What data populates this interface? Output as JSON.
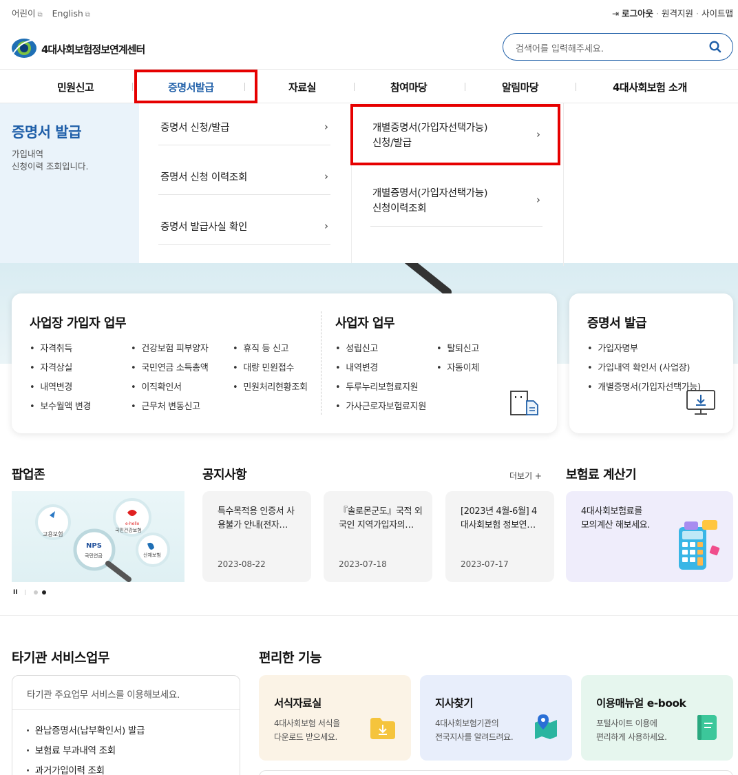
{
  "utility": {
    "kids": "어린이",
    "english": "English",
    "logout": "로그아웃",
    "remote": "원격지원",
    "sitemap": "사이트맵",
    "dot": "·"
  },
  "brand": {
    "name": "4대사회보험정보연계센터"
  },
  "search": {
    "placeholder": "검색어를 입력해주세요."
  },
  "gnb": [
    "민원신고",
    "증명서발급",
    "자료실",
    "참여마당",
    "알림마당",
    "4대사회보험 소개"
  ],
  "dropdown": {
    "title": "증명서 발급",
    "desc1": "가입내역",
    "desc2": "신청이력 조회입니다.",
    "col1": [
      "증명서 신청/발급",
      "증명서 신청 이력조회",
      "증명서 발급사실 확인"
    ],
    "col2": [
      {
        "l1": "개별증명서(가입자선택가능)",
        "l2": "신청/발급"
      },
      {
        "l1": "개별증명서(가입자선택가능)",
        "l2": "신청이력조회"
      }
    ]
  },
  "cards": {
    "biz_member": {
      "title": "사업장 가입자 업무",
      "items": [
        "자격취득",
        "자격상실",
        "내역변경",
        "보수월액 변경",
        "건강보험 피부양자",
        "국민연금 소득총액",
        "이직확인서",
        "근무처 변동신고",
        "휴직 등 신고",
        "대량 민원접수",
        "민원처리현황조회"
      ]
    },
    "employer": {
      "title": "사업자 업무",
      "items": [
        "성립신고",
        "내역변경",
        "두루누리보험료지원",
        "가사근로자보험료지원",
        "탈퇴신고",
        "자동이체"
      ]
    },
    "cert": {
      "title": "증명서 발급",
      "items": [
        "가입자명부",
        "가입내역 확인서 (사업장)",
        "개별증명서(가입자선택가능)"
      ]
    }
  },
  "popup": {
    "title": "팝업존",
    "labels": {
      "employment": "고용보험",
      "health1": "e-hello",
      "health2": "국민건강보험",
      "nps": "NPS",
      "nps_sub": "국민연금",
      "industrial": "산재보험"
    },
    "pause": "II"
  },
  "notices": {
    "title": "공지사항",
    "more": "더보기 +",
    "items": [
      {
        "title": "특수목적용 인증서 사용불가 안내(전자…",
        "date": "2023-08-22"
      },
      {
        "title": "『솔로몬군도』국적 외국인 지역가입자의…",
        "date": "2023-07-18"
      },
      {
        "title": "[2023년 4월-6월] 4대사회보험 정보연…",
        "date": "2023-07-17"
      }
    ]
  },
  "calc": {
    "title": "보험료 계산기",
    "desc1": "4대사회보험료를",
    "desc2": "모의계산 해보세요."
  },
  "other": {
    "title": "타기관 서비스업무",
    "subtitle": "타기관 주요업무 서비스를 이용해보세요.",
    "items": [
      "완납증명서(납부확인서) 발급",
      "보험료 부과내역 조회",
      "과거가입이력 조회"
    ]
  },
  "features": {
    "title": "편리한 기능",
    "items": [
      {
        "title": "서식자료실",
        "s1": "4대사회보험 서식을",
        "s2": "다운로드 받으세요.",
        "bg": "#fbf3e6"
      },
      {
        "title": "지사찾기",
        "s1": "4대사회보험기관의",
        "s2": "전국지사를 알려드려요.",
        "bg": "#e8eefb"
      },
      {
        "title": "이용매뉴얼 e-book",
        "s1": "포털사이트 이용에",
        "s2": "편리하게 사용하세요.",
        "bg": "#e6f6ee"
      }
    ]
  },
  "colors": {
    "accent": "#1f5fa8",
    "highlight": "#e60000",
    "title_blue": "#1e5ea8"
  }
}
